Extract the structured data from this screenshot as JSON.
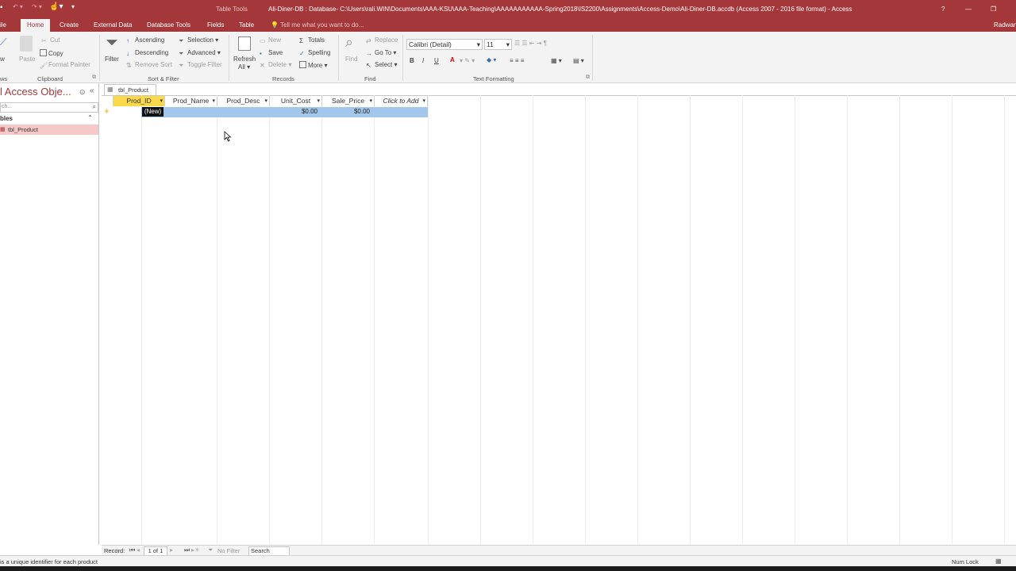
{
  "titlebar": {
    "context_tab": "Table Tools",
    "title": "Ali-Diner-DB : Database- C:\\Users\\rali.WIN\\Documents\\AAA-KSU\\AAA-Teaching\\AAAAAAAAAAA-Spring2018\\IS2200\\Assignments\\Access-Demo\\Ali-Diner-DB.accdb (Access 2007 - 2016 file format) - Access",
    "help": "?",
    "minimize": "—",
    "restore": "❐"
  },
  "tabs": {
    "file": "ile",
    "home": "Home",
    "create": "Create",
    "external": "External Data",
    "dbtools": "Database Tools",
    "fields": "Fields",
    "table": "Table",
    "tell": "Tell me what you want to do...",
    "user": "Radwan"
  },
  "ribbon": {
    "views_label": "ws",
    "paste": "Paste",
    "cut": "Cut",
    "copy": "Copy",
    "format_painter": "Format Painter",
    "clipboard_group": "Clipboard",
    "filter": "Filter",
    "ascending": "Ascending",
    "descending": "Descending",
    "remove_sort": "Remove Sort",
    "selection": "Selection",
    "advanced": "Advanced",
    "toggle_filter": "Toggle Filter",
    "sortfilter_group": "Sort & Filter",
    "refresh": "Refresh",
    "refresh_all": "All",
    "new": "New",
    "save": "Save",
    "delete": "Delete",
    "totals": "Totals",
    "spelling": "Spelling",
    "more": "More",
    "records_group": "Records",
    "find": "Find",
    "replace": "Replace",
    "goto": "Go To",
    "select": "Select",
    "find_group": "Find",
    "font_name": "Calibri (Detail)",
    "font_size": "11",
    "bold": "B",
    "italic": "I",
    "underline": "U",
    "font_color": "A",
    "textformat_group": "Text Formatting"
  },
  "nav": {
    "title": "l Access Obje...",
    "search_placeholder": "ch...",
    "section": "bles",
    "items": [
      {
        "label": "tbl_Product"
      }
    ]
  },
  "doc_tab": "tbl_Product",
  "columns": [
    {
      "label": "Prod_ID"
    },
    {
      "label": "Prod_Name"
    },
    {
      "label": "Prod_Desc"
    },
    {
      "label": "Unit_Cost"
    },
    {
      "label": "Sale_Price"
    },
    {
      "label": "Click to Add"
    }
  ],
  "new_row": {
    "selector": "✳",
    "prod_id": "(New)",
    "unit_cost": "$0.00",
    "sale_price": "$0.00"
  },
  "record_nav": {
    "label": "Record:",
    "position": "1 of 1",
    "filter": "No Filter",
    "search": "Search"
  },
  "status": {
    "left": "is a unique identifier for each product",
    "num_lock": "Num Lock"
  },
  "colors": {
    "accent": "#a4373a",
    "header_active": "#f9d849",
    "row_selected": "#a3c7ea",
    "nav_selected": "#f6c8c8"
  }
}
